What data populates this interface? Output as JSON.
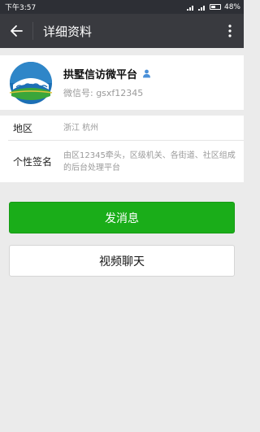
{
  "status_bar": {
    "time": "下午3:57",
    "battery": "48%"
  },
  "header": {
    "title": "详细资料"
  },
  "profile": {
    "name": "拱墅信访微平台",
    "wechat_id": "微信号: gsxf12345"
  },
  "details": {
    "region_label": "地区",
    "region_value": "浙江  杭州",
    "signature_label": "个性签名",
    "signature_value": "由区12345牵头，区级机关、各街道、社区组成的后台处理平台"
  },
  "actions": {
    "send_message": "发消息",
    "video_chat": "视频聊天"
  },
  "colors": {
    "primary_green": "#1aad19",
    "title_bar": "#393a3f",
    "status_bar": "#2d2f35",
    "background": "#ebebeb"
  },
  "icons": [
    "back-arrow-icon",
    "more-vertical-icon",
    "contact-person-icon",
    "signal-icon",
    "battery-icon"
  ]
}
